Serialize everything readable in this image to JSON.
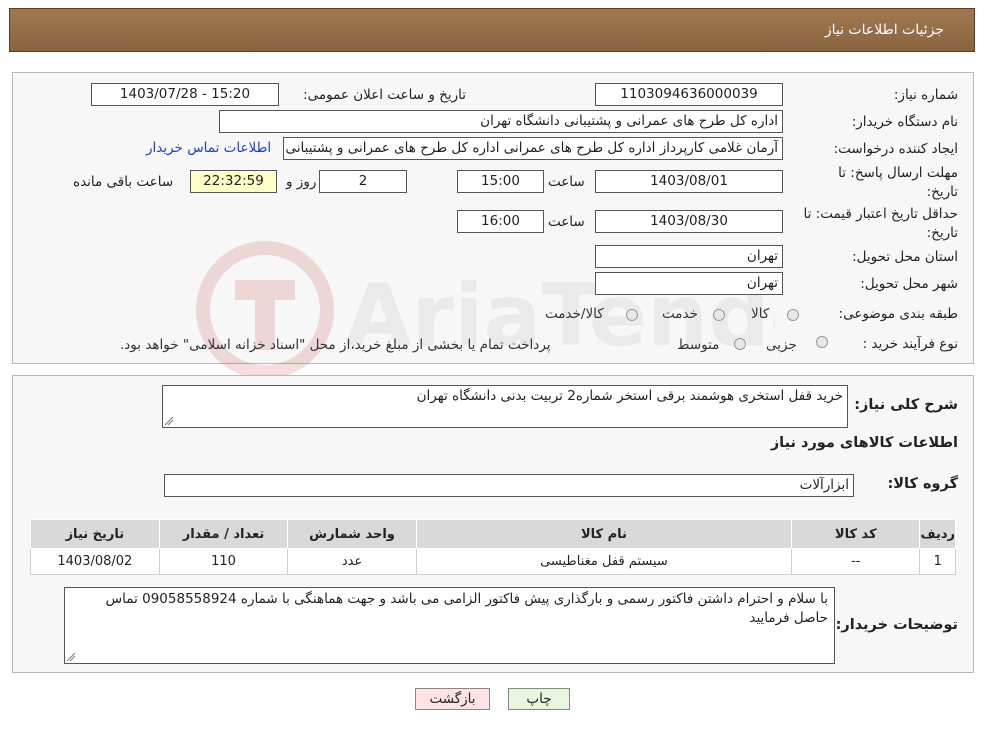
{
  "header": {
    "title": "جزئیات اطلاعات نیاز"
  },
  "form": {
    "need_number_label": "شماره نیاز:",
    "need_number": "1103094636000039",
    "announce_label": "تاریخ و ساعت اعلان عمومی:",
    "announce_value": "1403/07/28 - 15:20",
    "buyer_org_label": "نام دستگاه خریدار:",
    "buyer_org": "اداره کل طرح های عمرانی و پشتیبانی دانشگاه تهران",
    "requester_label": "ایجاد کننده درخواست:",
    "requester": "آرمان غلامی کارپرداز اداره کل طرح های عمرانی اداره کل طرح های عمرانی و پشتیبانی دانشگاه تهران",
    "contact_link": "اطلاعات تماس خریدار",
    "deadline_label_1": "مهلت ارسال پاسخ: تا",
    "deadline_label_2": "تاریخ:",
    "deadline_date": "1403/08/01",
    "time_label": "ساعت",
    "deadline_time": "15:00",
    "days_value": "2",
    "days_label": "روز و",
    "remaining_time": "22:32:59",
    "remaining_label": "ساعت باقی مانده",
    "validity_label_1": "حداقل تاریخ اعتبار قیمت: تا",
    "validity_label_2": "تاریخ:",
    "validity_date": "1403/08/30",
    "validity_time_label": "ساعت",
    "validity_time": "16:00",
    "province_label": "استان محل تحویل:",
    "province": "تهران",
    "city_label": "شهر محل تحویل:",
    "city": "تهران",
    "category_label": "طبقه بندی موضوعی:",
    "category_options": [
      "کالا",
      "خدمت",
      "کالا/خدمت"
    ],
    "process_label": "نوع فرآیند خرید :",
    "process_options": [
      "جزیی",
      "متوسط"
    ],
    "process_note": "پرداخت تمام یا بخشی از مبلغ خرید،از محل \"اسناد خزانه اسلامی\" خواهد بود."
  },
  "details": {
    "summary_label": "شرح کلی نیاز:",
    "summary": "خرید قفل استخری هوشمند برقی استخر شماره2 تربیت بدنی دانشگاه تهران",
    "goods_info_title": "اطلاعات کالاهای مورد نیاز",
    "goods_group_label": "گروه کالا:",
    "goods_group": "ابزارآلات",
    "table_headers": [
      "ردیف",
      "کد کالا",
      "نام کالا",
      "واحد شمارش",
      "تعداد / مقدار",
      "تاریخ نیاز"
    ],
    "table_rows": [
      [
        "1",
        "--",
        "سیستم قفل مغناطیسی",
        "عدد",
        "110",
        "1403/08/02"
      ]
    ],
    "buyer_notes_label": "توضیحات خریدار:",
    "buyer_notes": "با سلام و احترام داشتن فاکتور رسمی و بارگذاری پیش فاکتور الزامی می باشد و جهت هماهنگی با شماره 09058558924 تماس حاصل فرمایید"
  },
  "buttons": {
    "back": "بازگشت",
    "print": "چاپ"
  },
  "watermark": {
    "text": "AriaTender.neT"
  },
  "colors": {
    "header": "#8a6440",
    "link": "#1a3fd6",
    "remaining_bg": "#ffffc8",
    "back_bg": "#fde3e3",
    "print_bg": "#e6f7e0"
  }
}
